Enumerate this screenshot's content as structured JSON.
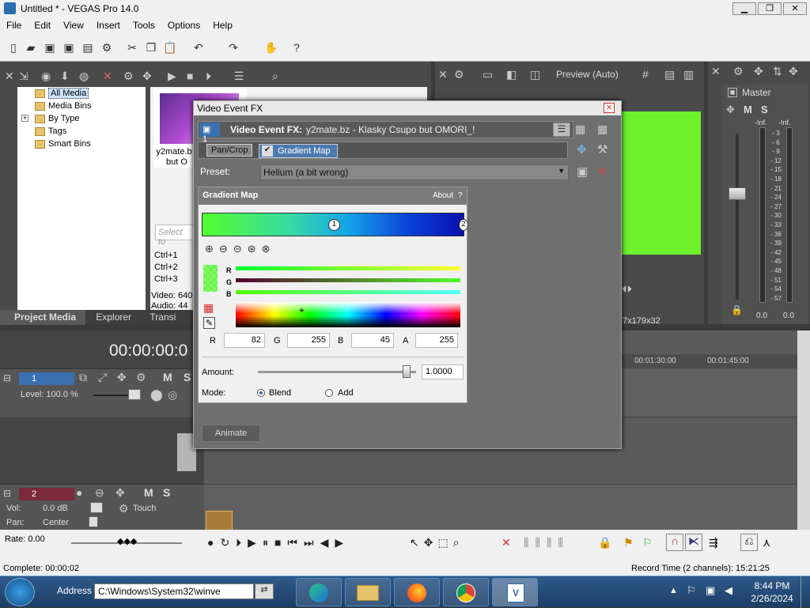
{
  "window": {
    "title": "Untitled * - VEGAS Pro 14.0",
    "min": "▁",
    "max": "❐",
    "close": "✕"
  },
  "menu": [
    "File",
    "Edit",
    "View",
    "Insert",
    "Tools",
    "Options",
    "Help"
  ],
  "project_media": {
    "tree": [
      {
        "label": "All Media",
        "selected": true
      },
      {
        "label": "Media Bins"
      },
      {
        "label": "By Type",
        "expander": "+"
      },
      {
        "label": "Tags"
      },
      {
        "label": "Smart Bins"
      }
    ],
    "thumb_caption_1": "y2mate.b",
    "thumb_caption_2": "but O",
    "search_placeholder": "Select to",
    "shortcuts": [
      "Ctrl+1",
      "Ctrl+2",
      "Ctrl+3"
    ],
    "info_video": "Video: 640",
    "info_audio": "Audio: 44",
    "tabs": [
      "Project Media",
      "Explorer",
      "Transi"
    ]
  },
  "preview": {
    "mode": "Preview (Auto)",
    "dims": "7x179x32"
  },
  "master": {
    "label": "Master",
    "inf_left": "-Inf.",
    "inf_right": "-Inf.",
    "scale": [
      "3",
      "6",
      "9",
      "12",
      "15",
      "18",
      "21",
      "24",
      "27",
      "30",
      "33",
      "36",
      "39",
      "42",
      "45",
      "48",
      "51",
      "54",
      "57"
    ],
    "val_left": "0.0",
    "val_right": "0.0"
  },
  "timeline": {
    "timecode": "00:00:00:0",
    "ruler_marks": [
      "00:01:30:00",
      "00:01:45:00"
    ],
    "video_track": {
      "num": "1",
      "level": "Level: 100.0 %"
    },
    "audio_track": {
      "num": "2",
      "vol_label": "Vol:",
      "vol": "0.0 dB",
      "pan_label": "Pan:",
      "pan": "Center",
      "touch": "Touch"
    },
    "rate": "Rate: 0.00"
  },
  "status": {
    "complete": "Complete: 00:00:02",
    "record_time": "Record Time (2 channels): 15:21:25"
  },
  "dialog": {
    "title": "Video Event FX",
    "event_label": "Video Event FX:",
    "event_name": "y2mate.bz - Klasky Csupo but OMORI_!",
    "chain_num": "1",
    "chain": [
      "Pan/Crop",
      "Gradient Map"
    ],
    "preset_label": "Preset:",
    "preset_value": "Helium (a bit wrong)",
    "plugin_title": "Gradient Map",
    "about": "About",
    "help": "?",
    "gradient_marker_1": "1",
    "gradient_marker_2": "2",
    "channel_labels": [
      "R",
      "G",
      "B"
    ],
    "rgba_labels": [
      "R",
      "G",
      "B",
      "A"
    ],
    "rgba_values": [
      "82",
      "255",
      "45",
      "255"
    ],
    "amount_label": "Amount:",
    "amount_value": "1.0000",
    "amount_level": 0.94,
    "mode_label": "Mode:",
    "modes": [
      "Blend",
      "Add"
    ],
    "mode_selected": "Blend",
    "animate": "Animate"
  },
  "taskbar": {
    "address_label": "Address",
    "address_value": "C:\\Windows\\System32\\winve",
    "time": "8:44 PM",
    "date": "2/26/2024"
  },
  "colors": {
    "preview_green": "#6cf12c",
    "accent": "#3a6fb0"
  }
}
